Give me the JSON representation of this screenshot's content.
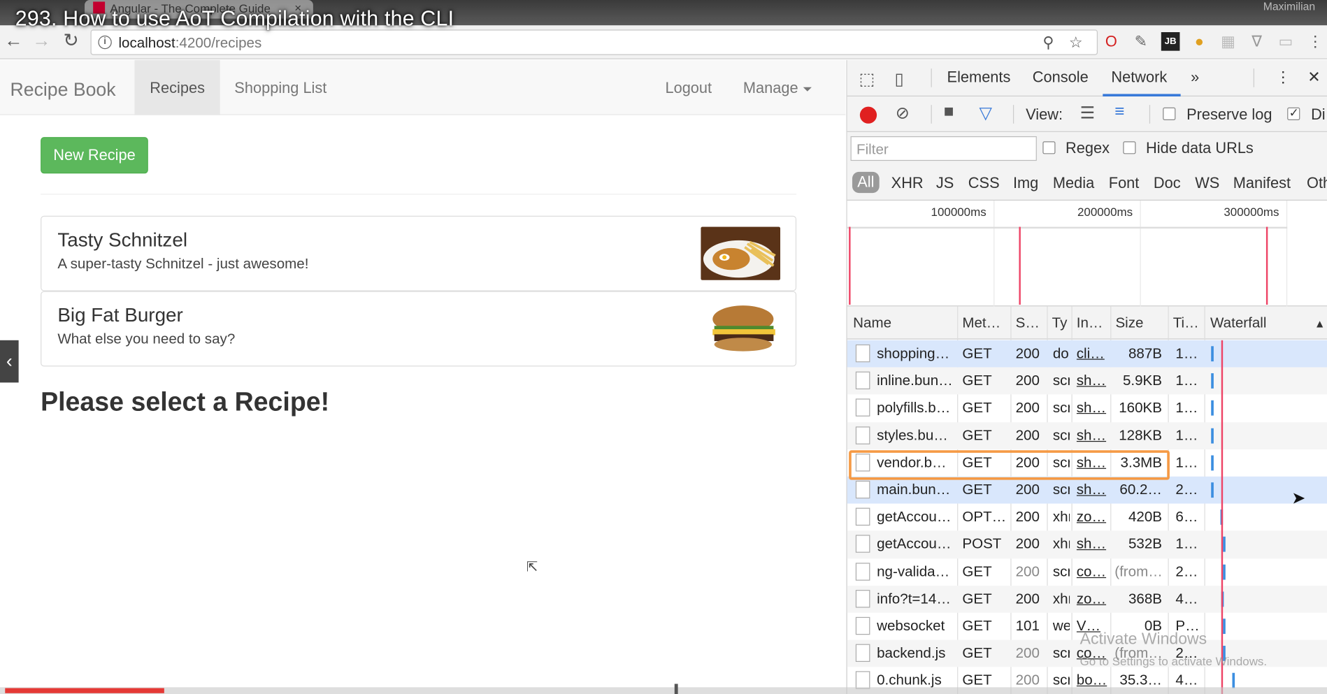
{
  "video_title": "293. How to use AoT Compilation with the CLI",
  "browser": {
    "tab_title": "Angular - The Complete Guide",
    "tab_close": "×",
    "user": "Maximilian",
    "url_host": "localhost",
    "url_path": ":4200/recipes",
    "back": "←",
    "forward": "→",
    "reload": "↻"
  },
  "app": {
    "brand": "Recipe Book",
    "nav": {
      "recipes": "Recipes",
      "shopping_list": "Shopping List",
      "logout": "Logout",
      "manage": "Manage"
    },
    "new_recipe_button": "New Recipe",
    "recipes": [
      {
        "name": "Tasty Schnitzel",
        "description": "A super-tasty Schnitzel - just awesome!"
      },
      {
        "name": "Big Fat Burger",
        "description": "What else you need to say?"
      }
    ],
    "select_message": "Please select a Recipe!"
  },
  "devtools": {
    "tabs": {
      "elements": "Elements",
      "console": "Console",
      "network": "Network",
      "more": "»",
      "menu": "⋮",
      "close": "✕"
    },
    "toolbar": {
      "view": "View:",
      "preserve_log": "Preserve log",
      "disable_cache": "Di"
    },
    "filter": {
      "placeholder": "Filter",
      "regex": "Regex",
      "hide_data_urls": "Hide data URLs"
    },
    "types": {
      "all": "All",
      "xhr": "XHR",
      "js": "JS",
      "css": "CSS",
      "img": "Img",
      "media": "Media",
      "font": "Font",
      "doc": "Doc",
      "ws": "WS",
      "manifest": "Manifest",
      "other": "Oth"
    },
    "overview_ticks": [
      "100000ms",
      "200000ms",
      "300000ms"
    ],
    "columns": {
      "name": "Name",
      "method": "Met…",
      "status": "S…",
      "type": "Ty",
      "initiator": "In…",
      "size": "Size",
      "time": "Ti…",
      "waterfall": "Waterfall",
      "sort": "▲"
    },
    "requests": [
      {
        "name": "shopping…",
        "method": "GET",
        "status": "200",
        "type": "do",
        "initiator": "cli…",
        "size": "887B",
        "time": "1…"
      },
      {
        "name": "inline.bun…",
        "method": "GET",
        "status": "200",
        "type": "scr",
        "initiator": "sh…",
        "size": "5.9KB",
        "time": "1…"
      },
      {
        "name": "polyfills.b…",
        "method": "GET",
        "status": "200",
        "type": "scr",
        "initiator": "sh…",
        "size": "160KB",
        "time": "1…"
      },
      {
        "name": "styles.bu…",
        "method": "GET",
        "status": "200",
        "type": "scr",
        "initiator": "sh…",
        "size": "128KB",
        "time": "1…"
      },
      {
        "name": "vendor.b…",
        "method": "GET",
        "status": "200",
        "type": "scr",
        "initiator": "sh…",
        "size": "3.3MB",
        "time": "1…"
      },
      {
        "name": "main.bun…",
        "method": "GET",
        "status": "200",
        "type": "scr",
        "initiator": "sh…",
        "size": "60.2…",
        "time": "2…"
      },
      {
        "name": "getAccou…",
        "method": "OPT…",
        "status": "200",
        "type": "xhr",
        "initiator": "zo…",
        "size": "420B",
        "time": "6…"
      },
      {
        "name": "getAccou…",
        "method": "POST",
        "status": "200",
        "type": "xhr",
        "initiator": "sh…",
        "size": "532B",
        "time": "1…"
      },
      {
        "name": "ng-valida…",
        "method": "GET",
        "status": "200",
        "type": "scr",
        "initiator": "co…",
        "size": "(from…",
        "time": "2…"
      },
      {
        "name": "info?t=14…",
        "method": "GET",
        "status": "200",
        "type": "xhr",
        "initiator": "zo…",
        "size": "368B",
        "time": "4…"
      },
      {
        "name": "websocket",
        "method": "GET",
        "status": "101",
        "type": "we",
        "initiator": "V…",
        "size": "0B",
        "time": "P…"
      },
      {
        "name": "backend.js",
        "method": "GET",
        "status": "200",
        "type": "scr",
        "initiator": "co…",
        "size": "(from…",
        "time": "2…"
      },
      {
        "name": "0.chunk.js",
        "method": "GET",
        "status": "200",
        "type": "scr",
        "initiator": "bo…",
        "size": "35.3…",
        "time": "4…"
      }
    ]
  },
  "watermark": {
    "title": "Activate Windows",
    "subtitle": "Go to Settings to activate Windows."
  },
  "player": {
    "progress": 0.12
  },
  "colors": {
    "accent": "#3879d9",
    "record": "#e02020",
    "success": "#5cb85c",
    "highlight": "#f59a45"
  }
}
